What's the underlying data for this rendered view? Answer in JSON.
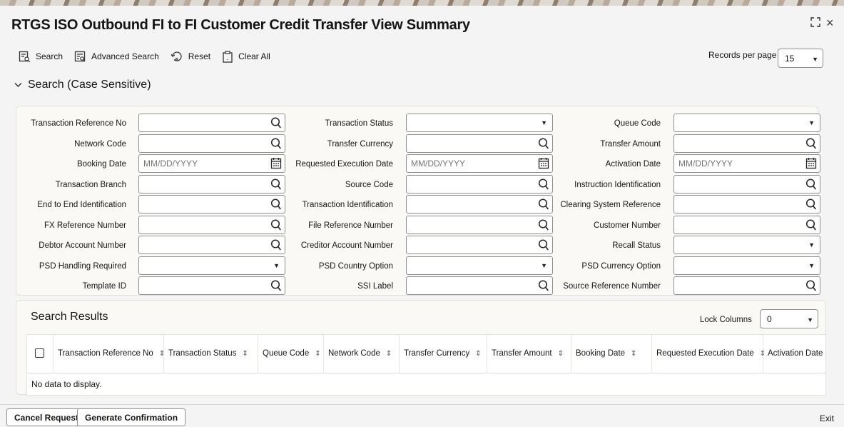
{
  "window": {
    "title": "RTGS ISO Outbound FI to FI Customer Credit Transfer View Summary",
    "close_glyph": "×",
    "expand_glyph": "⤢"
  },
  "toolbar": {
    "search_label": "Search",
    "advanced_search_label": "Advanced Search",
    "reset_label": "Reset",
    "clear_all_label": "Clear All",
    "records_per_page_label": "Records per page",
    "records_per_page_value": "15"
  },
  "search_section": {
    "title": "Search (Case Sensitive)",
    "date_placeholder": "MM/DD/YYYY",
    "rows": [
      [
        {
          "label": "Transaction Reference No",
          "type": "lookup"
        },
        {
          "label": "Transaction Status",
          "type": "select"
        },
        {
          "label": "Queue Code",
          "type": "select"
        }
      ],
      [
        {
          "label": "Network Code",
          "type": "lookup"
        },
        {
          "label": "Transfer Currency",
          "type": "lookup"
        },
        {
          "label": "Transfer Amount",
          "type": "lookup"
        }
      ],
      [
        {
          "label": "Booking Date",
          "type": "date"
        },
        {
          "label": "Requested Execution Date",
          "type": "date"
        },
        {
          "label": "Activation Date",
          "type": "date"
        }
      ],
      [
        {
          "label": "Transaction Branch",
          "type": "lookup"
        },
        {
          "label": "Source Code",
          "type": "lookup"
        },
        {
          "label": "Instruction Identification",
          "type": "lookup"
        }
      ],
      [
        {
          "label": "End to End Identification",
          "type": "lookup"
        },
        {
          "label": "Transaction Identification",
          "type": "lookup"
        },
        {
          "label": "Clearing System Reference",
          "type": "lookup"
        }
      ],
      [
        {
          "label": "FX Reference Number",
          "type": "lookup"
        },
        {
          "label": "File Reference Number",
          "type": "lookup"
        },
        {
          "label": "Customer Number",
          "type": "lookup"
        }
      ],
      [
        {
          "label": "Debtor Account Number",
          "type": "lookup"
        },
        {
          "label": "Creditor Account Number",
          "type": "lookup"
        },
        {
          "label": "Recall Status",
          "type": "select"
        }
      ],
      [
        {
          "label": "PSD Handling Required",
          "type": "select"
        },
        {
          "label": "PSD Country Option",
          "type": "select"
        },
        {
          "label": "PSD Currency Option",
          "type": "select"
        }
      ],
      [
        {
          "label": "Template ID",
          "type": "lookup"
        },
        {
          "label": "SSI Label",
          "type": "lookup"
        },
        {
          "label": "Source Reference Number",
          "type": "lookup"
        }
      ]
    ]
  },
  "results": {
    "title": "Search Results",
    "lock_columns_label": "Lock Columns",
    "lock_columns_value": "0",
    "columns": [
      {
        "label": "Transaction Reference No",
        "sortable": true
      },
      {
        "label": "Transaction Status",
        "sortable": true
      },
      {
        "label": "Queue Code",
        "sortable": true
      },
      {
        "label": "Network Code",
        "sortable": true
      },
      {
        "label": "Transfer Currency",
        "sortable": true
      },
      {
        "label": "Transfer Amount",
        "sortable": true
      },
      {
        "label": "Booking Date",
        "sortable": true
      },
      {
        "label": "Requested Execution Date",
        "sortable": true
      },
      {
        "label": "Activation Date",
        "sortable": false
      }
    ],
    "empty_message": "No data to display."
  },
  "footer": {
    "cancel_request_label": "Cancel Request",
    "generate_confirmation_label": "Generate Confirmation",
    "exit_label": "Exit"
  },
  "colors": {
    "panel_bg": "#fbf9f6",
    "page_bg": "#f4f4f4",
    "border": "#8f8f8f"
  }
}
